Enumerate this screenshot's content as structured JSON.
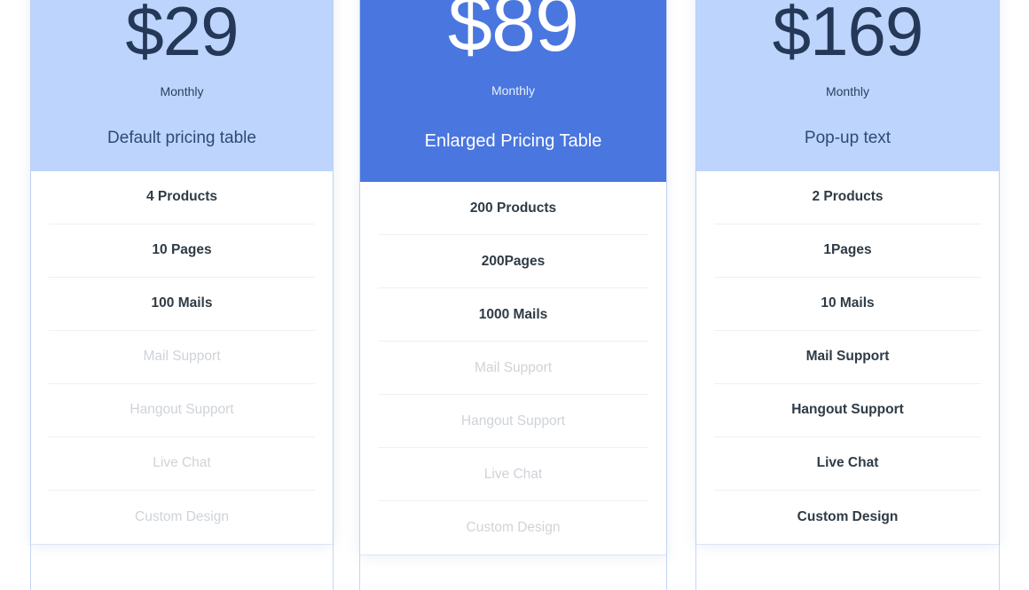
{
  "theme": {
    "light_blue": "#bdd5fc",
    "accent_blue": "#4a76df",
    "price_navy": "#253858",
    "feature_text": "#2f3b45",
    "feature_muted": "#cfd3d8",
    "divider": "#eef0f3",
    "card_bg": "#ffffff",
    "page_bg": "#ffffff"
  },
  "plans": [
    {
      "id": "default",
      "price": "$29",
      "period": "Monthly",
      "name": "Default pricing table",
      "highlighted": false,
      "features": [
        {
          "label": "4 Products",
          "enabled": true
        },
        {
          "label": "10 Pages",
          "enabled": true
        },
        {
          "label": "100 Mails",
          "enabled": true
        },
        {
          "label": "Mail Support",
          "enabled": false
        },
        {
          "label": "Hangout Support",
          "enabled": false
        },
        {
          "label": "Live Chat",
          "enabled": false
        },
        {
          "label": "Custom Design",
          "enabled": false
        }
      ]
    },
    {
      "id": "enlarged",
      "price": "$89",
      "period": "Monthly",
      "name": "Enlarged Pricing Table",
      "highlighted": true,
      "features": [
        {
          "label": "200 Products",
          "enabled": true
        },
        {
          "label": "200Pages",
          "enabled": true
        },
        {
          "label": "1000 Mails",
          "enabled": true
        },
        {
          "label": "Mail Support",
          "enabled": false
        },
        {
          "label": "Hangout Support",
          "enabled": false
        },
        {
          "label": "Live Chat",
          "enabled": false
        },
        {
          "label": "Custom Design",
          "enabled": false
        }
      ]
    },
    {
      "id": "popup",
      "price": "$169",
      "period": "Monthly",
      "name": "Pop-up text",
      "highlighted": false,
      "features": [
        {
          "label": "2 Products",
          "enabled": true
        },
        {
          "label": "1Pages",
          "enabled": true
        },
        {
          "label": "10 Mails",
          "enabled": true
        },
        {
          "label": "Mail Support",
          "enabled": true
        },
        {
          "label": "Hangout Support",
          "enabled": true
        },
        {
          "label": "Live Chat",
          "enabled": true
        },
        {
          "label": "Custom Design",
          "enabled": true
        }
      ]
    }
  ]
}
